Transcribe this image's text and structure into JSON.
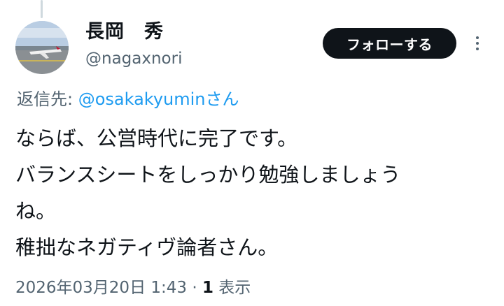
{
  "author": {
    "display_name": "長岡　秀",
    "handle": "@nagaxnori"
  },
  "follow_button_label": "フォローする",
  "reply": {
    "prefix": "返信先: ",
    "mention": "@osakakyumin",
    "suffix": "さん"
  },
  "tweet": {
    "lines": [
      "ならば、公営時代に完了です。",
      "バランスシートをしっかり勉強しましょう",
      "ね。",
      "稚拙なネガティヴ論者さん。"
    ]
  },
  "meta": {
    "timestamp": "2026年03月20日 1:43",
    "separator": " · ",
    "views_count": "1",
    "views_label": " 表示"
  },
  "icons": {
    "more": "more-dots-vertical-icon"
  },
  "colors": {
    "text_primary": "#0f1419",
    "text_secondary": "#536471",
    "link": "#1d9bf0",
    "follow_button_bg": "#0f1419",
    "thread_line": "#cfd9de"
  }
}
